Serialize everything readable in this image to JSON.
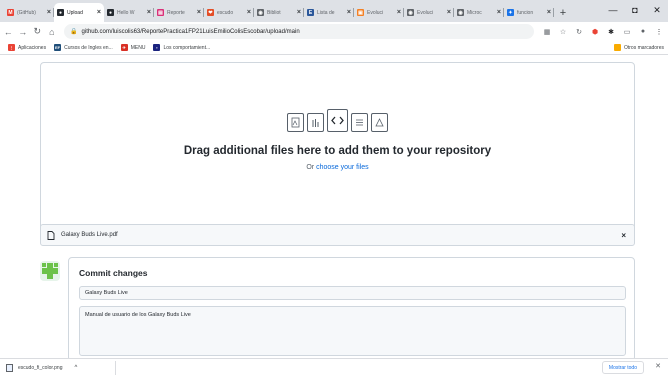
{
  "tabs": [
    {
      "title": "(GitHub)",
      "favicon": "gmail-icon",
      "color": "#ea4335",
      "glyph": "M",
      "active": false
    },
    {
      "title": "Upload",
      "favicon": "github-icon",
      "color": "#24292f",
      "glyph": "●",
      "active": true
    },
    {
      "title": "Hello W",
      "favicon": "github-icon",
      "color": "#24292f",
      "glyph": "●",
      "active": false
    },
    {
      "title": "Reporte",
      "favicon": "slides-icon",
      "color": "#d93078",
      "glyph": "▤",
      "active": false
    },
    {
      "title": "escudo",
      "favicon": "escudo-icon",
      "color": "#e44d26",
      "glyph": "❤",
      "active": false
    },
    {
      "title": "Bibliot",
      "favicon": "globe-icon",
      "color": "#5f6368",
      "glyph": "◉",
      "active": false
    },
    {
      "title": "Lista de",
      "favicon": "doc-icon",
      "color": "#2b579a",
      "glyph": "E",
      "active": false
    },
    {
      "title": "Evoluci",
      "favicon": "orange-icon",
      "color": "#f48024",
      "glyph": "▣",
      "active": false
    },
    {
      "title": "Evoluci",
      "favicon": "globe-icon",
      "color": "#5f6368",
      "glyph": "◉",
      "active": false
    },
    {
      "title": "Microc",
      "favicon": "globe-icon",
      "color": "#5f6368",
      "glyph": "◉",
      "active": false
    },
    {
      "title": "funcion",
      "favicon": "blue-star-icon",
      "color": "#1a73e8",
      "glyph": "✦",
      "active": false
    }
  ],
  "window_controls": {
    "minimize": "—",
    "restore": "◘",
    "close": "✕"
  },
  "url": "github.com/luiscolis63/ReportePractica1FP21LuisEmilioColisEscobar/upload/main",
  "bookmarks": [
    {
      "label": "Aplicaciones",
      "icon": "apps-icon",
      "color": "#ea4335",
      "glyph": "⋮"
    },
    {
      "label": "Cursos de Ingles en...",
      "icon": "ef-icon",
      "color": "#1f4e79",
      "glyph": "EF"
    },
    {
      "label": "MENU",
      "icon": "arrow-icon",
      "color": "#d93025",
      "glyph": "✈"
    },
    {
      "label": "Los comportamient...",
      "icon": "bookmark-icon",
      "color": "#1a237e",
      "glyph": "▪"
    }
  ],
  "other_bookmarks": "Otros marcadores",
  "dropzone": {
    "title": "Drag additional files here to add them to your repository",
    "or_text": "Or ",
    "link_text": "choose your files"
  },
  "file": {
    "name": "Galaxy Buds Live.pdf",
    "remove": "×"
  },
  "commit": {
    "heading": "Commit changes",
    "summary": "Galaxy Buds Live",
    "description": "Manual de usuario de los Galaxy Buds Live"
  },
  "downloads": {
    "file": "escudo_fi_color.png",
    "show_all": "Mostrar todo",
    "close": "✕"
  }
}
